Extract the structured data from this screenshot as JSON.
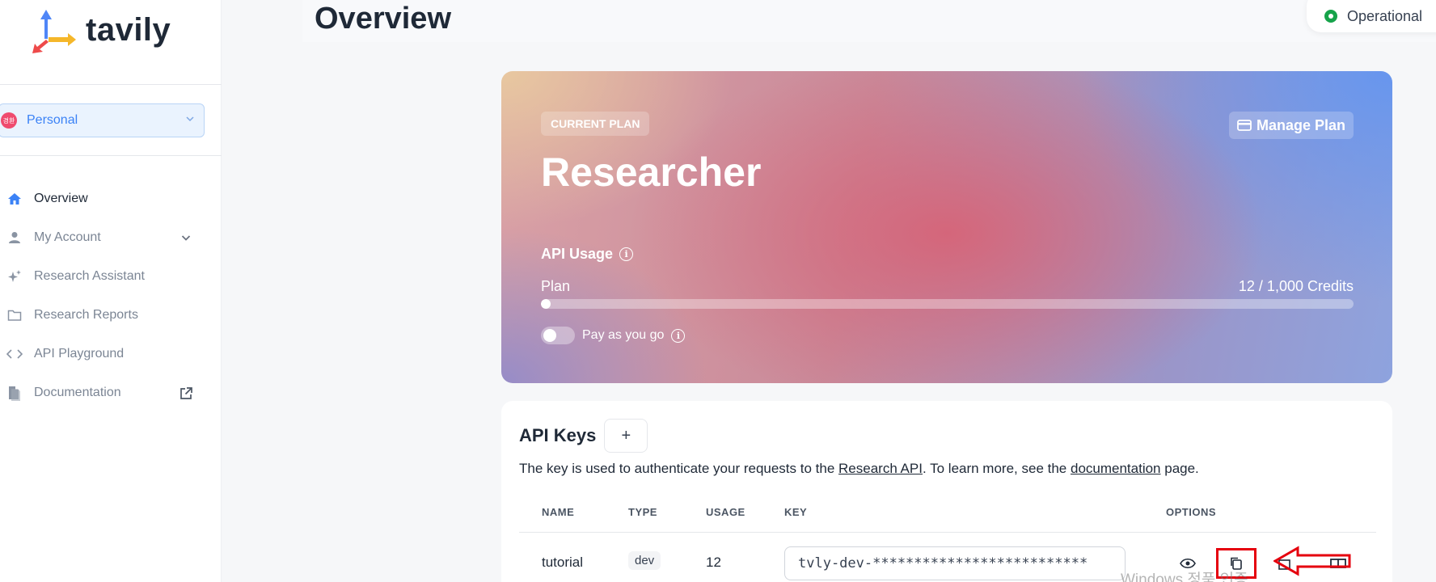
{
  "brand": {
    "name": "tavily"
  },
  "workspace": {
    "avatar_text": "경환",
    "label": "Personal"
  },
  "sidebar": {
    "items": [
      {
        "label": "Overview",
        "icon": "home-icon",
        "active": true
      },
      {
        "label": "My Account",
        "icon": "user-icon",
        "expandable": true
      },
      {
        "label": "Research Assistant",
        "icon": "sparkles-icon"
      },
      {
        "label": "Research Reports",
        "icon": "folder-icon"
      },
      {
        "label": "API Playground",
        "icon": "code-icon"
      },
      {
        "label": "Documentation",
        "icon": "document-icon",
        "external": true
      }
    ]
  },
  "header": {
    "title": "Overview",
    "status": "Operational"
  },
  "plan": {
    "badge": "CURRENT PLAN",
    "manage_label": "Manage Plan",
    "name": "Researcher",
    "usage_title": "API Usage",
    "plan_label": "Plan",
    "credits_text": "12 / 1,000 Credits",
    "usage_fraction": 0.012,
    "payg_label": "Pay as you go",
    "payg_enabled": false
  },
  "api_keys": {
    "title": "API Keys",
    "add_label": "+",
    "desc_prefix": "The key is used to authenticate your requests to the ",
    "desc_link1": "Research API",
    "desc_middle": ". To learn more, see the ",
    "desc_link2": "documentation",
    "desc_suffix": " page.",
    "columns": {
      "name": "NAME",
      "type": "TYPE",
      "usage": "USAGE",
      "key": "KEY",
      "options": "OPTIONS"
    },
    "rows": [
      {
        "name": "tutorial",
        "type": "dev",
        "usage": "12",
        "key": "tvly-dev-**************************"
      }
    ]
  },
  "overlay": {
    "watermark": "Windows 정품 인증"
  },
  "colors": {
    "accent": "#3b82f6",
    "status": "#16a34a",
    "annotation": "#e5000e"
  }
}
